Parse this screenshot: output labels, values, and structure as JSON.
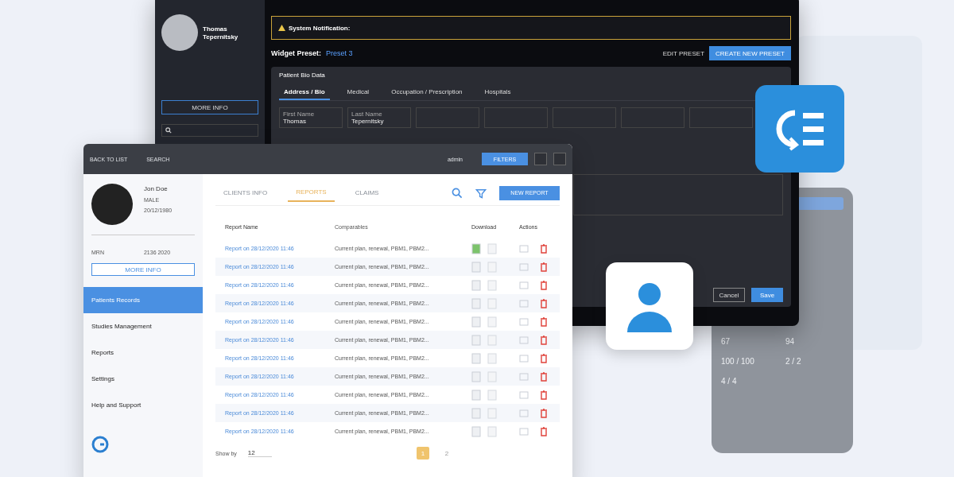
{
  "dark_window": {
    "user": {
      "first_name": "Thomas",
      "last_name": "Tepernitsky"
    },
    "more_info": "MORE INFO",
    "notification": {
      "label": "System Notification:"
    },
    "preset": {
      "label": "Widget Preset:",
      "value": "Preset 3"
    },
    "edit_preset": "EDIT PRESET",
    "create_preset": "CREATE NEW PRESET",
    "panel_title": "Patient Bio Data",
    "tabs": [
      {
        "label": "Address / Bio",
        "selected": true
      },
      {
        "label": "Medical",
        "selected": false
      },
      {
        "label": "Occupation / Prescription",
        "selected": false
      },
      {
        "label": "Hospitals",
        "selected": false
      }
    ],
    "fields": [
      {
        "label": "First Name",
        "value": "Thomas"
      },
      {
        "label": "Last Name",
        "value": "Tepernitsky"
      }
    ],
    "cancel": "Cancel",
    "save": "Save"
  },
  "light_window": {
    "back": "BACK TO LIST",
    "search": "SEARCH",
    "admin": "admin",
    "filters": "FILTERS",
    "patient": {
      "name": "Jon Doe",
      "sex": "MALE",
      "birth": "20/12/1980",
      "mrn_label": "MRN",
      "mrn": "2136 2020"
    },
    "more_info": "MORE INFO",
    "sidebar": [
      {
        "label": "Patients Records",
        "selected": true
      },
      {
        "label": "Studies Management",
        "selected": false
      },
      {
        "label": "Reports",
        "selected": false
      },
      {
        "label": "Settings",
        "selected": false
      },
      {
        "label": "Help and Support",
        "selected": false
      }
    ],
    "tabs": [
      {
        "label": "CLIENTS INFO",
        "selected": false
      },
      {
        "label": "REPORTS",
        "selected": true
      },
      {
        "label": "CLAIMS",
        "selected": false
      }
    ],
    "new_report": "NEW REPORT",
    "columns": [
      "Report Name",
      "Comparables",
      "Download",
      "Actions"
    ],
    "rows": [
      {
        "name": "Report on 28/12/2020 11:46",
        "comparables": "Current plan, renewal, PBM1, PBM2...",
        "downloaded": true
      },
      {
        "name": "Report on 28/12/2020 11:46",
        "comparables": "Current plan, renewal, PBM1, PBM2...",
        "downloaded": false
      },
      {
        "name": "Report on 28/12/2020 11:46",
        "comparables": "Current plan, renewal, PBM1, PBM2...",
        "downloaded": false
      },
      {
        "name": "Report on 28/12/2020 11:46",
        "comparables": "Current plan, renewal, PBM1, PBM2...",
        "downloaded": false
      },
      {
        "name": "Report on 28/12/2020 11:46",
        "comparables": "Current plan, renewal, PBM1, PBM2...",
        "downloaded": false
      },
      {
        "name": "Report on 28/12/2020 11:46",
        "comparables": "Current plan, renewal, PBM1, PBM2...",
        "downloaded": false
      },
      {
        "name": "Report on 28/12/2020 11:46",
        "comparables": "Current plan, renewal, PBM1, PBM2...",
        "downloaded": false
      },
      {
        "name": "Report on 28/12/2020 11:46",
        "comparables": "Current plan, renewal, PBM1, PBM2...",
        "downloaded": false
      },
      {
        "name": "Report on 28/12/2020 11:46",
        "comparables": "Current plan, renewal, PBM1, PBM2...",
        "downloaded": false
      },
      {
        "name": "Report on 28/12/2020 11:46",
        "comparables": "Current plan, renewal, PBM1, PBM2...",
        "downloaded": false
      },
      {
        "name": "Report on 28/12/2020 11:46",
        "comparables": "Current plan, renewal, PBM1, PBM2...",
        "downloaded": false
      }
    ],
    "show_by": {
      "label": "Show by",
      "value": "12"
    },
    "pages": [
      {
        "label": "1",
        "selected": true
      },
      {
        "label": "2",
        "selected": false
      }
    ]
  },
  "phone": {
    "values": [
      "67",
      "94",
      "100 / 100",
      "2 / 2",
      "4 / 4"
    ]
  }
}
